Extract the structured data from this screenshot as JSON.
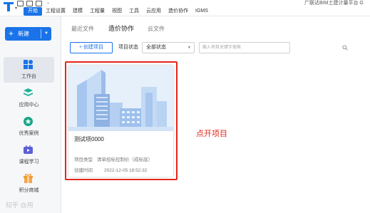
{
  "menu": {
    "items": [
      "开始",
      "工程设置",
      "建模",
      "工程量",
      "视图",
      "工具",
      "云应用",
      "造价协作",
      "IGMS"
    ],
    "active_index": 0
  },
  "app_title": "广联达BIM土建计量平台 G",
  "sidebar": {
    "new_button_label": "新建",
    "items": [
      {
        "label": "工作台",
        "icon": "workbench-icon",
        "active": true
      },
      {
        "label": "应用中心",
        "icon": "app-center-icon",
        "active": false
      },
      {
        "label": "优秀案例",
        "icon": "featured-cases-icon",
        "active": false
      },
      {
        "label": "课程学习",
        "icon": "course-video-icon",
        "active": false
      },
      {
        "label": "积分商城",
        "icon": "gift-icon",
        "active": false
      }
    ]
  },
  "tabs": [
    "最近文件",
    "造价协作",
    "云文件"
  ],
  "active_tab": "造价协作",
  "toolbar": {
    "create_label": "+ 创建项目",
    "status_label": "项目状态",
    "status_value": "全部状态",
    "search_placeholder": "输入项目关键字搜索"
  },
  "project_card": {
    "name": "测试项0000",
    "type_label": "项目类型",
    "type_value": "清单招标控制价（成标底）",
    "created_label": "创建时间",
    "created_value": "2022-12-05 18:52:32"
  },
  "annotation": "点开项目",
  "watermark": "知乎 @用",
  "colors": {
    "accent": "#1a73e8",
    "highlight": "#e3271b"
  }
}
